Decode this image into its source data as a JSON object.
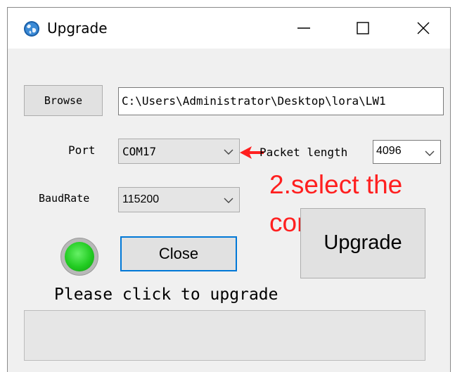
{
  "window": {
    "title": "Upgrade",
    "icon": "globe-icon"
  },
  "controls": {
    "minimize_icon": "minimize-icon",
    "maximize_icon": "maximize-icon",
    "close_icon": "close-icon"
  },
  "file": {
    "browse_label": "Browse",
    "path": "C:\\Users\\Administrator\\Desktop\\lora\\LW1"
  },
  "port": {
    "label": "Port",
    "selected": "COM17"
  },
  "packet": {
    "label": "Packet length",
    "selected": "4096"
  },
  "baud": {
    "label": "BaudRate",
    "selected": "115200"
  },
  "status": {
    "led_color": "#22cc22",
    "close_label": "Close",
    "upgrade_label": "Upgrade",
    "message": "Please click to upgrade",
    "progress": 0
  },
  "annotation": {
    "text": "2.select the com port",
    "color": "#ff1f1f"
  }
}
